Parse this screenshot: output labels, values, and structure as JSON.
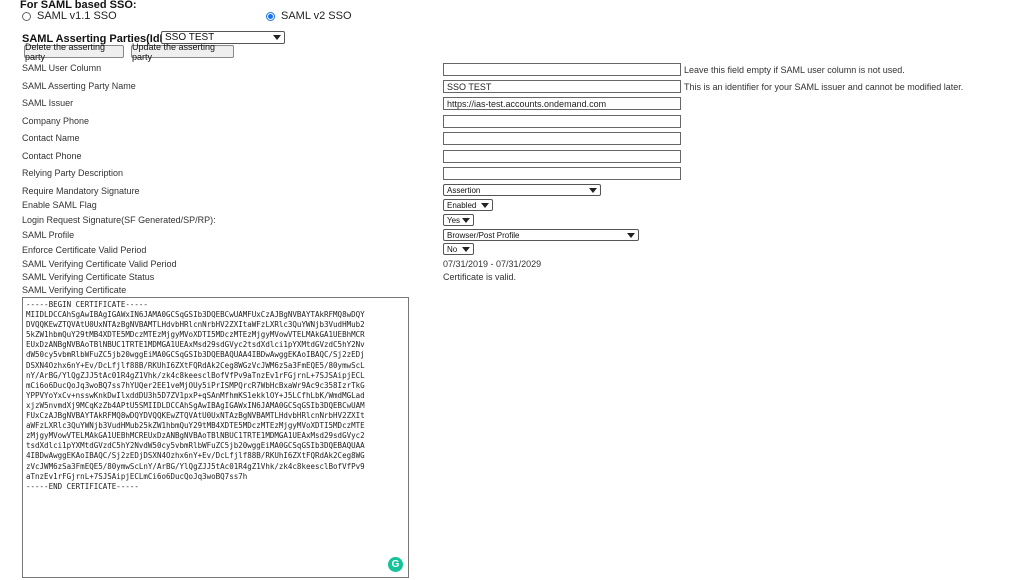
{
  "header": {
    "title": "For SAML based SSO:",
    "radio_v11": "SAML v1.1 SSO",
    "radio_v2": "SAML v2 SSO",
    "selected_version": "SAML v2 SSO"
  },
  "idp": {
    "label": "SAML Asserting Parties(IdP)",
    "selected": "SSO TEST",
    "delete_button": "Delete the asserting party",
    "update_button": "Update the asserting party"
  },
  "form": {
    "user_column": {
      "label": "SAML User Column",
      "value": "",
      "hint": "Leave this field empty if SAML user column is not used."
    },
    "party_name": {
      "label": "SAML Asserting Party Name",
      "value": "SSO TEST",
      "hint": "This is an identifier for your SAML issuer and cannot be modified later."
    },
    "issuer": {
      "label": "SAML Issuer",
      "value": "https://ias-test.accounts.ondemand.com"
    },
    "company_phone": {
      "label": "Company Phone",
      "value": ""
    },
    "contact_name": {
      "label": "Contact Name",
      "value": ""
    },
    "contact_phone": {
      "label": "Contact Phone",
      "value": ""
    },
    "relying_party": {
      "label": "Relying Party Description",
      "value": ""
    },
    "mandatory_signature": {
      "label": "Require Mandatory Signature",
      "value": "Assertion"
    },
    "enable_flag": {
      "label": "Enable SAML Flag",
      "value": "Enabled"
    },
    "login_signature": {
      "label": "Login Request Signature(SF Generated/SP/RP):",
      "value": "Yes"
    },
    "profile": {
      "label": "SAML Profile",
      "value": "Browser/Post Profile"
    },
    "enforce_period": {
      "label": "Enforce Certificate Valid Period",
      "value": "No"
    },
    "valid_period": {
      "label": "SAML Verifying Certificate Valid Period",
      "value": "07/31/2019 - 07/31/2029"
    },
    "cert_status": {
      "label": "SAML Verifying Certificate Status",
      "value": "Certificate is valid."
    },
    "certificate": {
      "label": "SAML Verifying Certificate",
      "value": "-----BEGIN CERTIFICATE-----\nMIIDLDCCAhSgAwIBAgIGAWxIN6JAMA0GCSqGSIb3DQEBCwUAMFUxCzAJBgNVBAYTAkRFMQ8wDQY\nDVQQKEwZTQVAtU0UxNTAzBgNVBAMTLHdvbHRlcnNrbHV2ZXItaWFzLXRlc3QuYWNjb3VudHMub2\n5kZW1hbmQuY29tMB4XDTE5MDczMTEzMjgyMVoXDTI5MDczMTEzMjgyMVowVTELMAkGA1UEBhMCR\nEUxDzANBgNVBAoTBlNBUC1TRTE1MDMGA1UEAxMsd29sdGVyc2tsdXdlci1pYXMtdGVzdC5hY2Nv\ndW50cy5vbmRlbWFuZC5jb20wggEiMA0GCSqGSIb3DQEBAQUAA4IBDwAwggEKAoIBAQC/Sj2zEDj\nDSXN4Ozhx6nY+Ev/DcLfjlf88B/RKUhI6ZXtFQRdAk2Ceg8WGzVcJWM6zSa3FmEQE5/80ymwScL\nnY/ArBG/YlQgZJJ5tAc01R4gZ1Vhk/zk4c8keesclBofVfPv9aTnzEv1rFGjrnL+7SJSAipjECL\nmCi6o6DucQoJq3woBQ7ss7hYUQer2EE1veMjOUy5iPrISMPQrcR7WbHcBxaWr9Ac9c358IzrTkG\nYPPVYoYxCv+nsswKnkDwIlxddDU3h5D7ZV1pxP+qSAnMfhmKS1ekklOY+J5LCfhLbK/WmdMGLad\nxjzW5nvmdXj9MCqKzZb4APtU5SMIIDLDCCAhSgAwIBAgIGAWxIN6JAMA0GCSqGSIb3DQEBCwUAM\nFUxCzAJBgNVBAYTAkRFMQ8wDQYDVQQKEwZTQVAtU0UxNTAzBgNVBAMTLHdvbHRlcnNrbHV2ZXIt\naWFzLXRlc3QuYWNjb3VudHMub25kZW1hbmQuY29tMB4XDTE5MDczMTEzMjgyMVoXDTI5MDczMTE\nzMjgyMVowVTELMAkGA1UEBhMCREUxDzANBgNVBAoTBlNBUC1TRTE1MDMGA1UEAxMsd29sdGVyc2\ntsdXdlci1pYXMtdGVzdC5hY2NvdW50cy5vbmRlbWFuZC5jb20wggEiMA0GCSqGSIb3DQEBAQUAA\n4IBDwAwggEKAoIBAQC/Sj2zEDjDSXN4Ozhx6nY+Ev/DcLfjlf88B/RKUhI6ZXtFQRdAk2Ceg8WG\nzVcJWM6zSa3FmEQE5/80ymwScLnY/ArBG/YlQgZJJ5tAc01R4gZ1Vhk/zk4c8keesclBofVfPv9\naTnzEv1rFGjrnL+7SJSAipjECLmCi6o6DucQoJq3woBQ7ss7h\n-----END CERTIFICATE-----"
    }
  },
  "icons": {
    "grammarly": "grammarly-icon"
  },
  "colors": {
    "radio_accent": "#1a73e8",
    "grammarly": "#15c39a"
  }
}
